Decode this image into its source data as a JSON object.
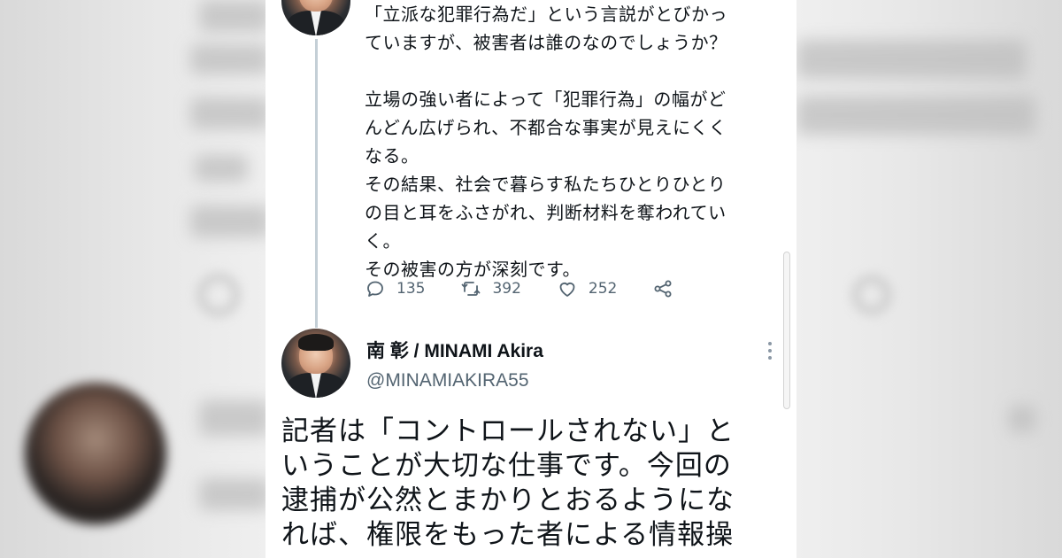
{
  "previous_tweet": {
    "text": "「立派な犯罪行為だ」という言説がとびかっ\nていますが、被害者は誰のなのでしょうか？\n\n立場の強い者によって「犯罪行為」の幅がど\nんどん広げられ、不都合な事実が見えにくく\nなる。\nその結果、社会で暮らす私たちひとりひとり\nの目と耳をふさがれ、判断材料を奪われてい\nく。\nその被害の方が深刻です。",
    "actions": {
      "reply_count": "135",
      "retweet_count": "392",
      "like_count": "252"
    }
  },
  "main_tweet": {
    "display_name": "南 彰 / MINAMI Akira",
    "handle": "@MINAMIAKIRA55",
    "text": "記者は「コントロールされない」と\nいうことが大切な仕事です。今回の\n逮捕が公然とまかりとおるようにな\nれば、権限をもった者による情報操"
  },
  "icons": [
    "reply-icon",
    "retweet-icon",
    "like-icon",
    "share-icon",
    "more-vertical-icon"
  ],
  "colors": {
    "text_primary": "#0f1419",
    "text_secondary": "#536471",
    "thread_line": "#c4cfd6",
    "card_background": "#ffffff",
    "backdrop": "#e6e6e6"
  }
}
